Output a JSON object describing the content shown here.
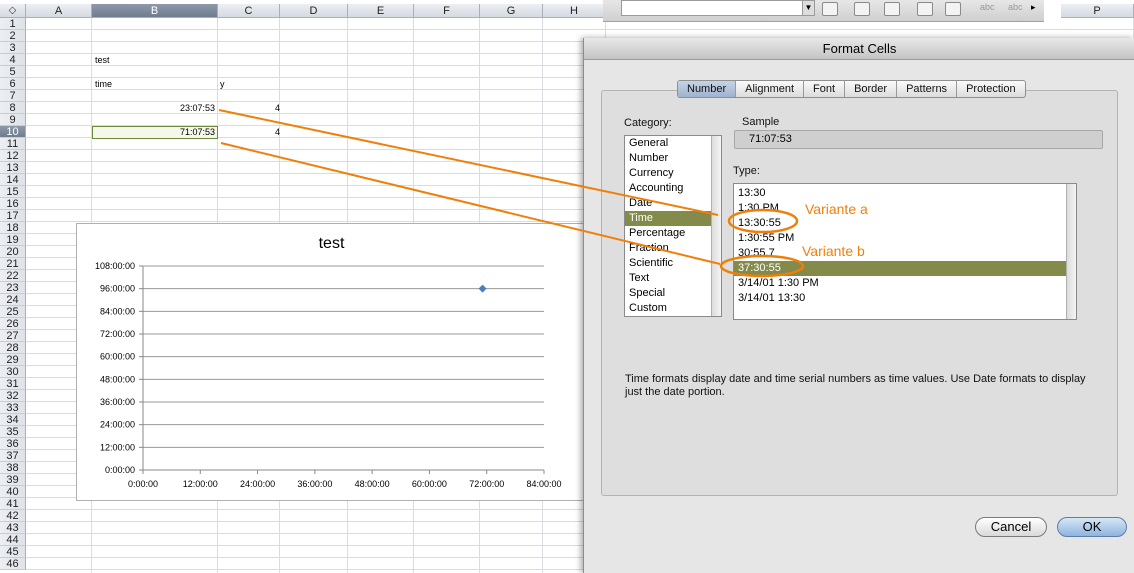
{
  "sheet": {
    "corner_icon": "select-all-diamond-icon",
    "columns": [
      "A",
      "B",
      "C",
      "D",
      "E",
      "F",
      "G",
      "H",
      "P"
    ],
    "rows": [
      "1",
      "2",
      "3",
      "4",
      "5",
      "6",
      "7",
      "8",
      "9",
      "10",
      "11",
      "12",
      "13",
      "14",
      "15",
      "16",
      "17",
      "18",
      "19",
      "20",
      "21",
      "22",
      "23",
      "24",
      "25",
      "26",
      "27",
      "28",
      "29",
      "30",
      "31",
      "32",
      "33",
      "34",
      "35",
      "36",
      "37",
      "38",
      "39",
      "40",
      "41",
      "42",
      "43",
      "44",
      "45",
      "46"
    ],
    "cells": {
      "b4": "test",
      "b6": "time",
      "c6": "y",
      "b8": "23:07:53",
      "c8": "4",
      "b10": "71:07:53",
      "c10": "4"
    },
    "selected_cell": "B10"
  },
  "chart_data": {
    "type": "scatter",
    "title": "test",
    "x_ticks": [
      "0:00:00",
      "12:00:00",
      "24:00:00",
      "36:00:00",
      "48:00:00",
      "60:00:00",
      "72:00:00",
      "84:00:00"
    ],
    "y_ticks": [
      "0:00:00",
      "12:00:00",
      "24:00:00",
      "36:00:00",
      "48:00:00",
      "60:00:00",
      "72:00:00",
      "84:00:00",
      "96:00:00",
      "108:00:00"
    ],
    "xlim_hours": [
      0,
      84
    ],
    "ylim_hours": [
      0,
      108
    ],
    "points": [
      {
        "x_hours": 71.13,
        "y_hours": 96
      }
    ],
    "grid": "horizontal",
    "marker_color": "#4a7ebb"
  },
  "dialog": {
    "title": "Format Cells",
    "tabs": [
      "Number",
      "Alignment",
      "Font",
      "Border",
      "Patterns",
      "Protection"
    ],
    "active_tab": "Number",
    "category_label": "Category:",
    "categories": [
      "General",
      "Number",
      "Currency",
      "Accounting",
      "Date",
      "Time",
      "Percentage",
      "Fraction",
      "Scientific",
      "Text",
      "Special",
      "Custom"
    ],
    "selected_category": "Time",
    "sample_label": "Sample",
    "sample_value": "71:07:53",
    "type_label": "Type:",
    "types": [
      "13:30",
      "1:30 PM",
      "13:30:55",
      "1:30:55 PM",
      "30:55.7",
      "37:30:55",
      "3/14/01 1:30 PM",
      "3/14/01 13:30"
    ],
    "selected_type": "37:30:55",
    "description": "Time formats display date and time serial numbers as time values.  Use Date formats to display just the date portion.",
    "cancel_label": "Cancel",
    "ok_label": "OK"
  },
  "annotations": {
    "variant_a": "Variante a",
    "variant_b": "Variante b",
    "color": "#f07f0a"
  }
}
